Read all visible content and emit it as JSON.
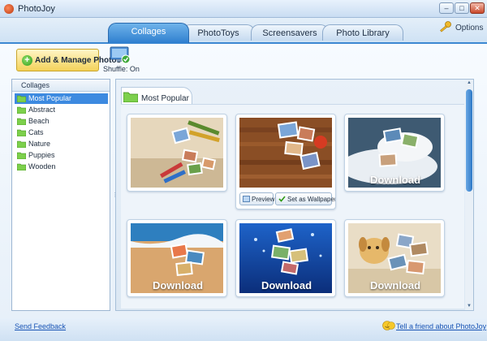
{
  "window": {
    "title": "PhotoJoy"
  },
  "tabs": [
    {
      "label": "Collages",
      "active": true
    },
    {
      "label": "PhotoToys",
      "active": false
    },
    {
      "label": "Screensavers",
      "active": false
    },
    {
      "label": "Photo Library",
      "active": false
    }
  ],
  "options_label": "Options",
  "toolbar": {
    "add_label": "Add & Manage Photos",
    "shuffle_label": "Shuffle: On"
  },
  "sidebar": {
    "title": "Collages",
    "items": [
      {
        "label": "Most Popular",
        "selected": true
      },
      {
        "label": "Abstract",
        "selected": false
      },
      {
        "label": "Beach",
        "selected": false
      },
      {
        "label": "Cats",
        "selected": false
      },
      {
        "label": "Nature",
        "selected": false
      },
      {
        "label": "Puppies",
        "selected": false
      },
      {
        "label": "Wooden",
        "selected": false
      }
    ]
  },
  "gallery": {
    "title": "Most Popular",
    "preview_label": "Preview",
    "wallpaper_label": "Set as Wallpaper",
    "download_label": "Download"
  },
  "footer": {
    "feedback_label": "Send Feedback",
    "tell_label": "Tell a friend about PhotoJoy"
  },
  "colors": {
    "accent": "#3d8ae0",
    "add_button": "#f4d25a",
    "link": "#1a55b5"
  }
}
